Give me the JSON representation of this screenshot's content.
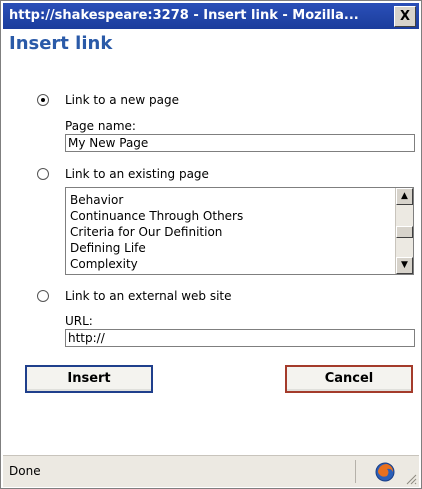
{
  "window": {
    "title": "http://shakespeare:3278 - Insert link - Mozilla...",
    "close_label": "X"
  },
  "dialog": {
    "heading": "Insert link",
    "option_new_page": "Link to a new page",
    "page_name_label": "Page name:",
    "page_name_value": "My New Page",
    "option_existing_page": "Link to an existing page",
    "pages": [
      "Behavior",
      "Continuance Through Others",
      "Criteria for Our Definition",
      "Defining Life",
      "Complexity"
    ],
    "option_external": "Link to an external web site",
    "url_label": "URL:",
    "url_value": "http://",
    "insert_label": "Insert",
    "cancel_label": "Cancel",
    "selected_option": "new_page"
  },
  "statusbar": {
    "text": "Done",
    "icon": "firefox-icon"
  },
  "colors": {
    "titlebar": "#1b3d9c",
    "heading": "#2a5aa8",
    "insert_border": "#1f3f8c",
    "cancel_border": "#a43b2b"
  }
}
